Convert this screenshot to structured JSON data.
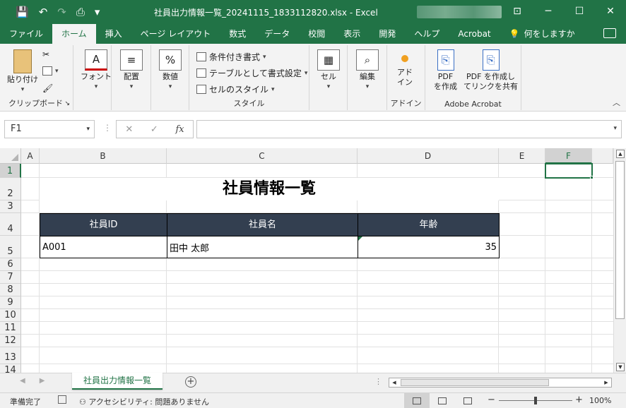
{
  "window": {
    "title": "社員出力情報一覧_20241115_1833112820.xlsx  -  Excel",
    "controls": {
      "minimize": "─",
      "maximize": "☐",
      "close": "✕",
      "ribbon_display": "⊡"
    }
  },
  "qat": {
    "save": "💾",
    "undo": "↶",
    "redo": "↷",
    "print_preview": "⎙",
    "customize": "▾"
  },
  "menu_tabs": [
    "ファイル",
    "ホーム",
    "挿入",
    "ページ レイアウト",
    "数式",
    "データ",
    "校閲",
    "表示",
    "開発",
    "ヘルプ",
    "Acrobat"
  ],
  "active_tab": "ホーム",
  "search_hint": "何をしますか",
  "ribbon": {
    "clipboard": {
      "paste": "貼り付け",
      "label": "クリップボード"
    },
    "font": {
      "button": "フォント"
    },
    "alignment": {
      "button": "配置"
    },
    "number": {
      "button": "数値"
    },
    "styles": {
      "conditional": "条件付き書式",
      "as_table": "テーブルとして書式設定",
      "cell_styles": "セルのスタイル",
      "label": "スタイル"
    },
    "cells": {
      "button": "セル"
    },
    "editing": {
      "button": "編集"
    },
    "addins": {
      "button_line1": "アド",
      "button_line2": "イン",
      "label": "アドイン"
    },
    "acrobat": {
      "create_pdf_line1": "PDF",
      "create_pdf_line2": "を作成",
      "share_line1": "PDF を作成し",
      "share_line2": "てリンクを共有",
      "label": "Adobe Acrobat"
    }
  },
  "formula_bar": {
    "name_box": "F1",
    "fx": "fx",
    "cancel": "✕",
    "enter": "✓",
    "formula": ""
  },
  "columns": [
    "A",
    "B",
    "C",
    "D",
    "E",
    "F"
  ],
  "selected_column": "F",
  "rows": [
    "1",
    "2",
    "3",
    "4",
    "5",
    "6",
    "7",
    "8",
    "9",
    "10",
    "11",
    "12",
    "13",
    "14"
  ],
  "selected_row": "1",
  "sheet": {
    "title": "社員情報一覧",
    "headers": [
      "社員ID",
      "社員名",
      "年齢"
    ],
    "record": {
      "id": "A001",
      "name": "田中 太郎",
      "age": "35"
    }
  },
  "sheet_tabs": [
    "社員出力情報一覧"
  ],
  "status": {
    "ready": "準備完了",
    "accessibility": "アクセシビリティ: 問題ありません",
    "zoom": "100%",
    "zoom_minus": "−",
    "zoom_plus": "+"
  },
  "colors": {
    "accent": "#217346",
    "table_header_bg": "#333f50"
  }
}
